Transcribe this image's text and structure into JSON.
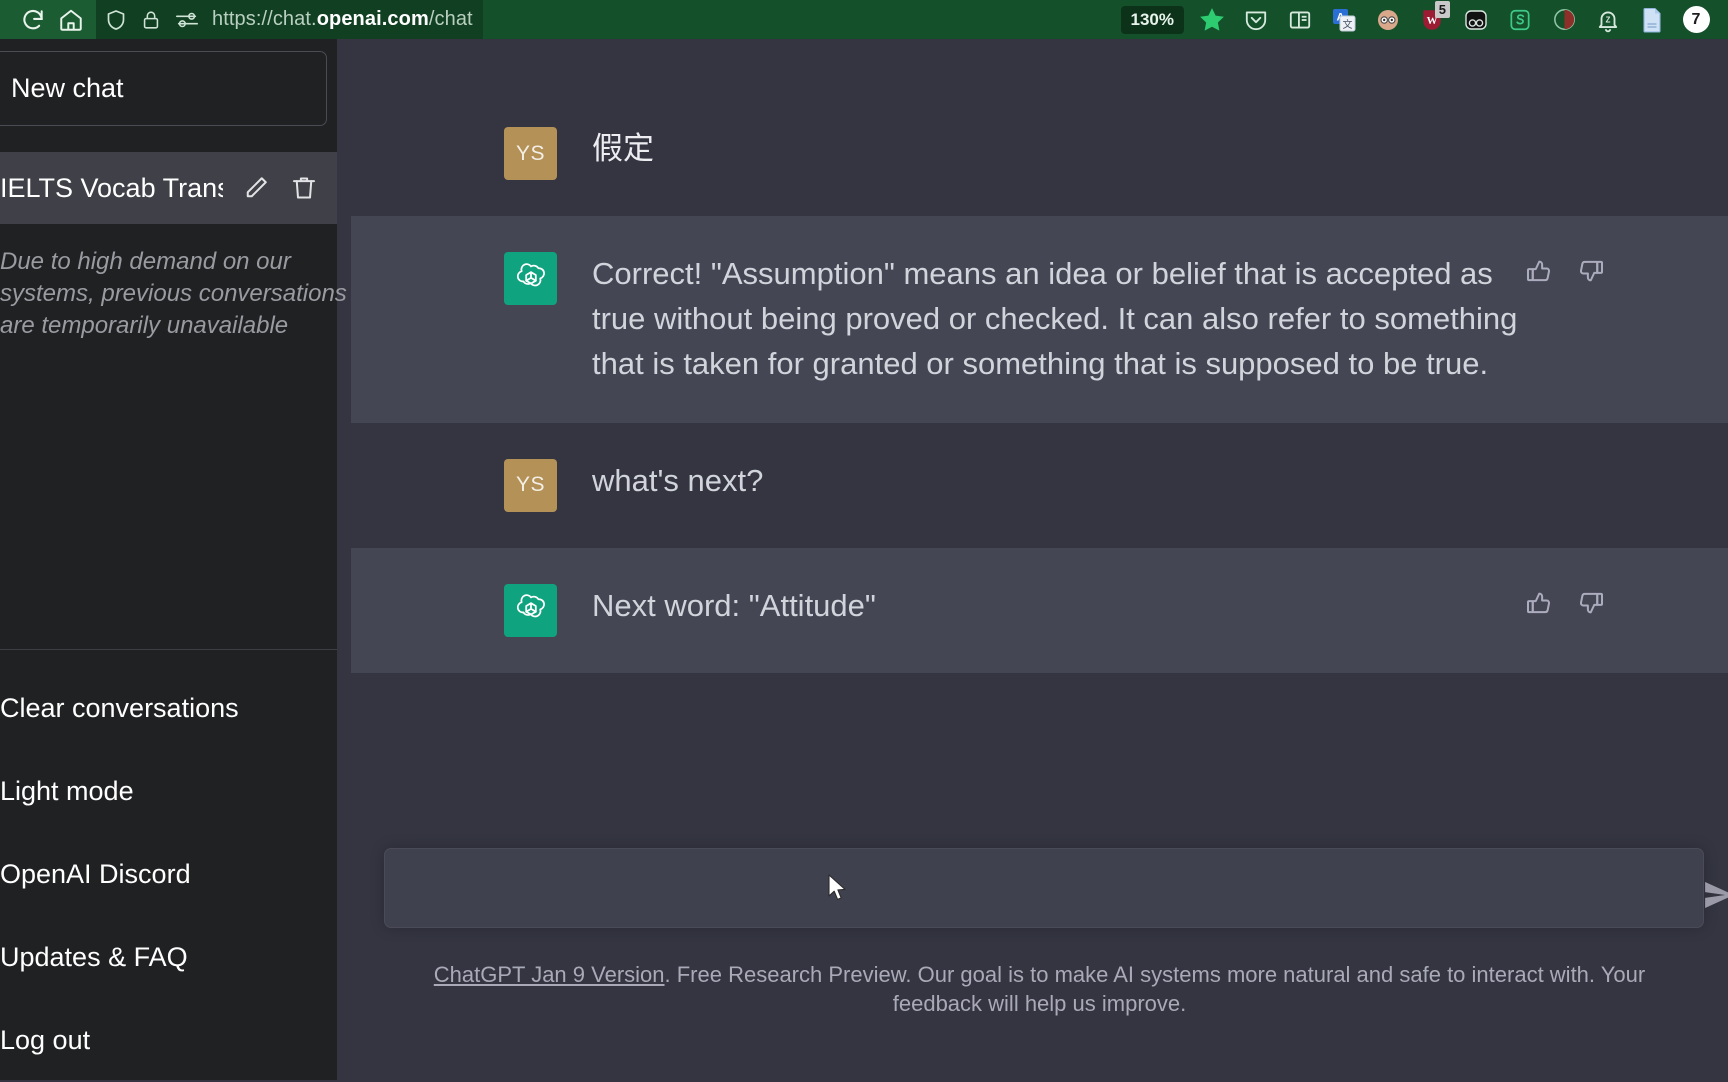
{
  "browser": {
    "reload_icon": "reload-icon",
    "home_icon": "home-icon",
    "shield_icon": "shield-icon",
    "lock_icon": "lock-icon",
    "permissions_icon": "permissions-icon",
    "url_prefix": "https://chat.",
    "url_domain": "openai.com",
    "url_path": "/chat",
    "zoom_level": "130%",
    "bookmark_icon": "star-icon",
    "extensions": [
      {
        "name": "pocket-icon",
        "glyph": "▽",
        "badge": ""
      },
      {
        "name": "reader-view-icon",
        "glyph": "▤",
        "badge": ""
      },
      {
        "name": "translate-icon",
        "glyph": "A",
        "badge": ""
      },
      {
        "name": "avatar-extension-icon",
        "glyph": "◉◉",
        "badge": ""
      },
      {
        "name": "wikipedia-extension-icon",
        "glyph": "w",
        "badge": "5"
      },
      {
        "name": "dark-reader-icon",
        "glyph": "oo",
        "badge": ""
      },
      {
        "name": "sider-extension-icon",
        "glyph": "S",
        "badge": ""
      },
      {
        "name": "theme-toggle-icon",
        "glyph": "◐",
        "badge": ""
      },
      {
        "name": "notification-bell-icon",
        "glyph": "🔔",
        "badge": ""
      },
      {
        "name": "document-icon",
        "glyph": "▤",
        "badge": ""
      }
    ],
    "account_badge": "7"
  },
  "sidebar": {
    "new_chat_label": "New chat",
    "conversation": {
      "title": "IELTS Vocab Translatio",
      "edit_icon": "pencil-icon",
      "delete_icon": "trash-icon"
    },
    "notice_line1": "Due to high demand on our",
    "notice_line2": "systems, previous conversations",
    "notice_line3": "are temporarily unavailable",
    "menu": [
      {
        "label": "Clear conversations",
        "name": "sidebar-item-clear-conversations"
      },
      {
        "label": "Light mode",
        "name": "sidebar-item-light-mode"
      },
      {
        "label": "OpenAI Discord",
        "name": "sidebar-item-openai-discord"
      },
      {
        "label": "Updates & FAQ",
        "name": "sidebar-item-updates-faq"
      },
      {
        "label": "Log out",
        "name": "sidebar-item-log-out"
      }
    ]
  },
  "chat": {
    "messages": [
      {
        "role": "user",
        "avatar_initials": "YS",
        "text": "假定"
      },
      {
        "role": "assistant",
        "text": "Correct! \"Assumption\" means an idea or belief that is accepted as true without being proved or checked. It can also refer to something that is taken for granted or something that is supposed to be true."
      },
      {
        "role": "user",
        "avatar_initials": "YS",
        "text": "what's next?"
      },
      {
        "role": "assistant",
        "text": "Next word: \"Attitude\""
      }
    ],
    "thumbs_up_icon": "thumbs-up-icon",
    "thumbs_down_icon": "thumbs-down-icon"
  },
  "composer": {
    "placeholder": "",
    "value": "",
    "send_icon": "send-icon"
  },
  "footer": {
    "link_text": "ChatGPT Jan 9 Version",
    "rest_text": ". Free Research Preview. Our goal is to make AI systems more natural and safe to interact with. Your feedback will help us improve."
  },
  "colors": {
    "brand_green": "#10a37f",
    "browser_green": "#14512b",
    "sidebar_bg": "#202123",
    "chat_bg": "#343541",
    "assistant_bg": "#444654",
    "user_avatar": "#b49156"
  }
}
